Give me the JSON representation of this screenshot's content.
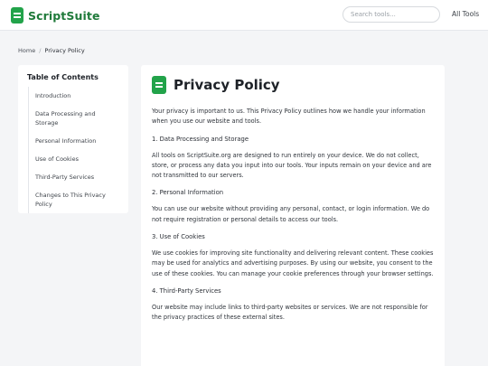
{
  "header": {
    "logo_text": "ScriptSuite",
    "search_placeholder": "Search tools...",
    "all_tools_label": "All Tools"
  },
  "breadcrumb": {
    "home": "Home",
    "separator": "/",
    "current": "Privacy Policy"
  },
  "toc": {
    "title": "Table of Contents",
    "items": [
      "Introduction",
      "Data Processing and Storage",
      "Personal Information",
      "Use of Cookies",
      "Third-Party Services",
      "Changes to This Privacy Policy"
    ]
  },
  "content": {
    "title": "Privacy Policy",
    "intro": "Your privacy is important to us. This Privacy Policy outlines how we handle your information when you use our website and tools.",
    "sections": [
      {
        "heading": "1. Data Processing and Storage",
        "body": "All tools on ScriptSuite.org are designed to run entirely on your device. We do not collect, store, or process any data you input into our tools. Your inputs remain on your device and are not transmitted to our servers."
      },
      {
        "heading": "2. Personal Information",
        "body": "You can use our website without providing any personal, contact, or login information. We do not require registration or personal details to access our tools."
      },
      {
        "heading": "3. Use of Cookies",
        "body": "We use cookies for improving site functionality and delivering relevant content. These cookies may be used for analytics and advertising purposes. By using our website, you consent to the use of these cookies. You can manage your cookie preferences through your browser settings."
      },
      {
        "heading": "4. Third-Party Services",
        "body": "Our website may include links to third-party websites or services. We are not responsible for the privacy practices of these external sites."
      }
    ]
  },
  "colors": {
    "brand_green": "#22a34a",
    "logo_text": "#1f7a3a",
    "page_bg": "#f4f5f7"
  }
}
